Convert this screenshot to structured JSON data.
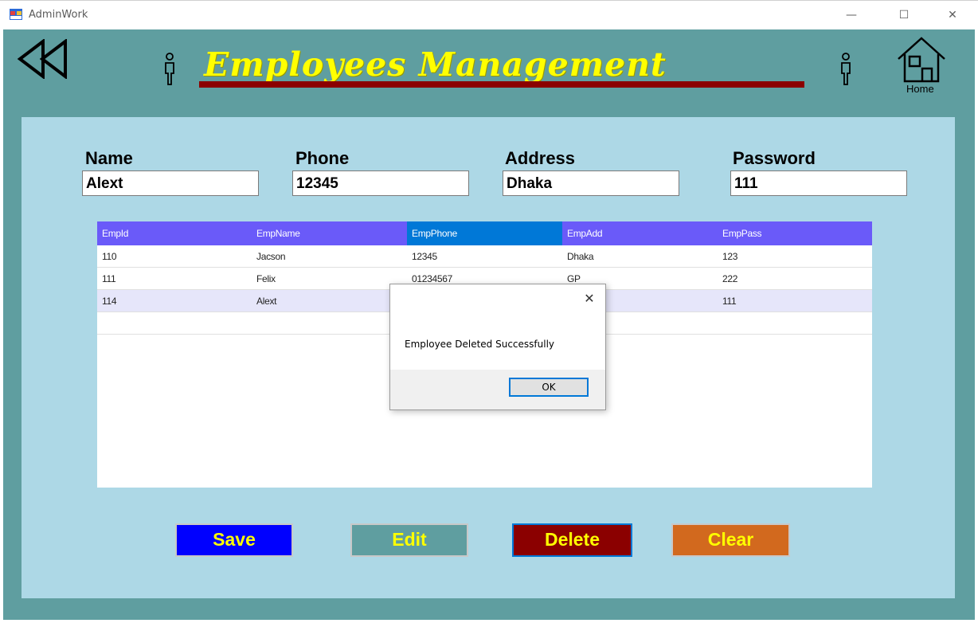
{
  "window": {
    "title": "AdminWork",
    "minimize_glyph": "—",
    "maximize_glyph": "☐",
    "close_glyph": "✕"
  },
  "header": {
    "title": "Employees Management",
    "home_label": "Home",
    "title_color": "#ffff00",
    "underline_color": "#8b0000"
  },
  "icons": {
    "app": "app-icon",
    "back": "rewind-icon",
    "home": "home-icon",
    "person": "person-icon"
  },
  "form": {
    "name": {
      "label": "Name",
      "value": "Alext"
    },
    "phone": {
      "label": "Phone",
      "value": "12345"
    },
    "address": {
      "label": "Address",
      "value": "Dhaka"
    },
    "password": {
      "label": "Password",
      "value": "111"
    }
  },
  "grid": {
    "columns": [
      "EmpId",
      "EmpName",
      "EmpPhone",
      "EmpAdd",
      "EmpPass"
    ],
    "rows": [
      [
        "110",
        "Jacson",
        "12345",
        "Dhaka",
        "123"
      ],
      [
        "111",
        "Felix",
        "01234567",
        "GP",
        "222"
      ],
      [
        "114",
        "Alext",
        "",
        "",
        "111"
      ]
    ],
    "header_color": "#6a5af9",
    "selected_header_color": "#0078d7"
  },
  "buttons": {
    "save": {
      "label": "Save",
      "bg": "#0000ff",
      "fg": "#ffff00"
    },
    "edit": {
      "label": "Edit",
      "bg": "#5f9ea0",
      "fg": "#ffff00"
    },
    "delete": {
      "label": "Delete",
      "bg": "#8b0000",
      "fg": "#ffff00"
    },
    "clear": {
      "label": "Clear",
      "bg": "#d2691e",
      "fg": "#ffff00"
    }
  },
  "dialog": {
    "close_glyph": "✕",
    "message": "Employee Deleted Successfully",
    "ok_label": "OK"
  }
}
